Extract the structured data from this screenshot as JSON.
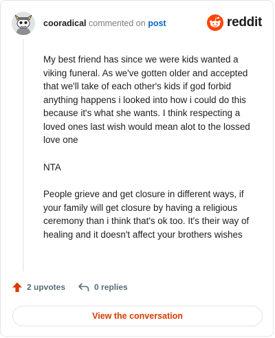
{
  "comment": {
    "username": "cooradical",
    "action_text": "commented on",
    "post_link_text": "post",
    "paragraphs": [
      "My best friend has since we were kids wanted a viking funeral. As we've gotten older and accepted that we'll take of each other's kids if god forbid anything happens i looked into how i could do this because it's what she wants. I think respecting a loved ones last wish would mean alot to the lossed love one",
      "NTA",
      "People grieve and get closure in different ways, if your family will get closure by having a religious ceremony than i think that's ok too. It's their way of healing and it doesn't affect your brothers wishes"
    ],
    "upvotes_text": "2 upvotes",
    "replies_text": "0 replies"
  },
  "brand": {
    "name": "reddit",
    "color": "#ff4500"
  },
  "cta": {
    "label": "View the conversation",
    "color": "#d93a00"
  },
  "icons": {
    "avatar": "snoo-avatar",
    "logo": "reddit-logo-icon",
    "upvote": "upvote-arrow-icon",
    "reply": "reply-arrow-icon"
  }
}
